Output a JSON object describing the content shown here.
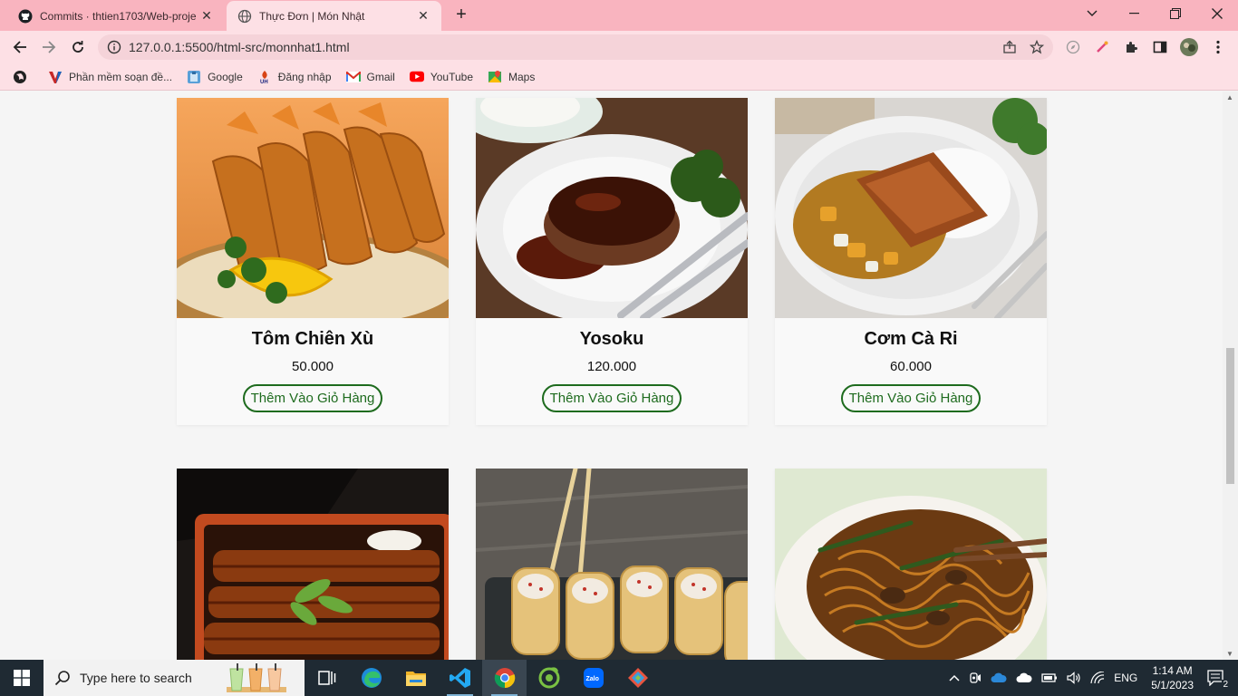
{
  "browser": {
    "tabs": [
      {
        "title": "Commits · thtien1703/Web-proje",
        "active": false
      },
      {
        "title": "Thực Đơn | Món Nhật",
        "active": true
      }
    ],
    "url": "127.0.0.1:5500/html-src/monnhat1.html",
    "bookmarks": [
      {
        "label": "Phần mềm soạn đề...",
        "icon": "v-logo-icon"
      },
      {
        "label": "Google",
        "icon": "google-icon"
      },
      {
        "label": "Đăng nhập",
        "icon": "login-icon"
      },
      {
        "label": "Gmail",
        "icon": "gmail-icon"
      },
      {
        "label": "YouTube",
        "icon": "youtube-icon"
      },
      {
        "label": "Maps",
        "icon": "maps-icon"
      }
    ]
  },
  "menu": {
    "button_label": "Thêm Vào Giỏ Hàng",
    "items": [
      {
        "name": "Tôm Chiên Xù",
        "price": "50.000"
      },
      {
        "name": "Yosoku",
        "price": "120.000"
      },
      {
        "name": "Cơm Cà Ri",
        "price": "60.000"
      },
      {
        "name": "",
        "price": ""
      },
      {
        "name": "",
        "price": ""
      },
      {
        "name": "",
        "price": ""
      }
    ]
  },
  "taskbar": {
    "search_placeholder": "Type here to search",
    "language": "ENG",
    "time": "1:14 AM",
    "date": "5/1/2023",
    "notification_count": "2",
    "apps": [
      "task-view-icon",
      "edge-icon",
      "file-explorer-icon",
      "vscode-icon",
      "chrome-icon",
      "coccoc-icon",
      "zalo-icon",
      "git-icon"
    ]
  },
  "colors": {
    "tabbar": "#f9b4bf",
    "toolbar": "#fde0e5",
    "button_green": "#1e6b1e",
    "taskbar": "#1f2a33"
  }
}
